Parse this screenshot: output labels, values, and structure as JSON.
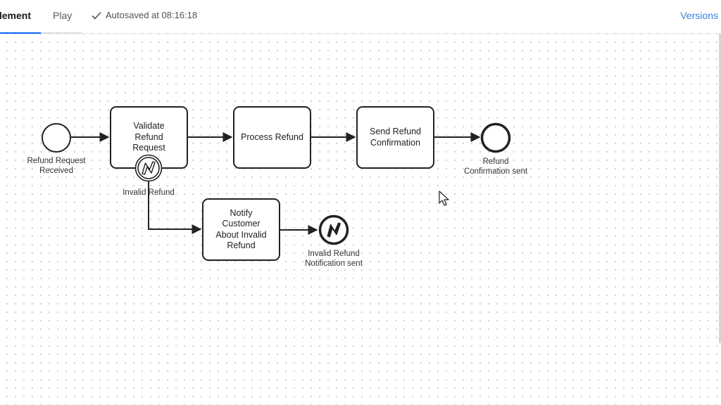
{
  "header": {
    "tabs": [
      {
        "label": "Implement",
        "active": true
      },
      {
        "label": "Play",
        "active": false
      }
    ],
    "autosave_text": "Autosaved at 08:16:18",
    "versions_label": "Versions"
  },
  "diagram": {
    "start_event": {
      "label_line1": "Refund Request",
      "label_line2": "Received"
    },
    "tasks": [
      {
        "id": "validate",
        "label_lines": [
          "Validate",
          "Refund",
          "Request"
        ]
      },
      {
        "id": "process",
        "label_lines": [
          "Process Refund"
        ]
      },
      {
        "id": "send",
        "label_lines": [
          "Send Refund",
          "Confirmation"
        ]
      },
      {
        "id": "notify",
        "label_lines": [
          "Notify",
          "Customer",
          "About Invalid",
          "Refund"
        ]
      }
    ],
    "boundary_event": {
      "label": "Invalid Refund"
    },
    "end_event": {
      "label_line1": "Refund",
      "label_line2": "Confirmation sent"
    },
    "error_end_event": {
      "label_line1": "Invalid Refund",
      "label_line2": "Notification sent"
    }
  },
  "colors": {
    "accent": "#0f62fe",
    "link": "#3d7fd9",
    "stroke": "#222222"
  }
}
